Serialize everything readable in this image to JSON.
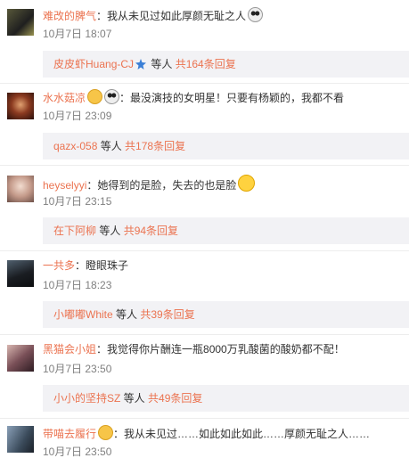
{
  "comments": [
    {
      "username": "难改的脾气",
      "text": "：我从未见过如此厚颜无耻之人",
      "emoji": [
        "panda-icon"
      ],
      "time": "10月7日 18:07",
      "reply_user": "皮皮虾Huang-CJ",
      "reply_badge": "badge-icon",
      "reply_mid": " 等人 ",
      "reply_count": "共164条回复"
    },
    {
      "username": "水水菇凉",
      "text": "：最没演技的女明星！只要有杨颖的，我都不看",
      "emoji_before": [
        "heart-eyes-icon",
        "panda-icon"
      ],
      "time": "10月7日 23:09",
      "reply_user": "qazx-058",
      "reply_mid": " 等人 ",
      "reply_count": "共178条回复"
    },
    {
      "username": "heyselyyi",
      "text": "：她得到的是脸，失去的也是脸",
      "emoji": [
        "grin-emoji-icon"
      ],
      "time": "10月7日 23:15",
      "reply_user": "在下阿柳",
      "reply_mid": " 等人 ",
      "reply_count": "共94条回复"
    },
    {
      "username": "一共多",
      "text": "：瞪眼珠子",
      "time": "10月7日 18:23",
      "reply_user": "小嘟嘟White",
      "reply_mid": " 等人 ",
      "reply_count": "共39条回复"
    },
    {
      "username": "黑猫会小姐",
      "text": "：我觉得你片酬连一瓶8000万乳酸菌的酸奶都不配！",
      "time": "10月7日 23:50",
      "reply_user": "小小的坚持SZ",
      "reply_mid": " 等人 ",
      "reply_count": "共49条回复"
    },
    {
      "username": "带喵去履行",
      "text": "：我从未见过……如此如此如此……厚颜无耻之人……",
      "emoji_before": [
        "heart-eyes-icon"
      ],
      "time": "10月7日 23:50"
    }
  ],
  "colors": {
    "link": "#eb7350",
    "reply_bg": "#f2f2f5",
    "time": "#808080"
  }
}
